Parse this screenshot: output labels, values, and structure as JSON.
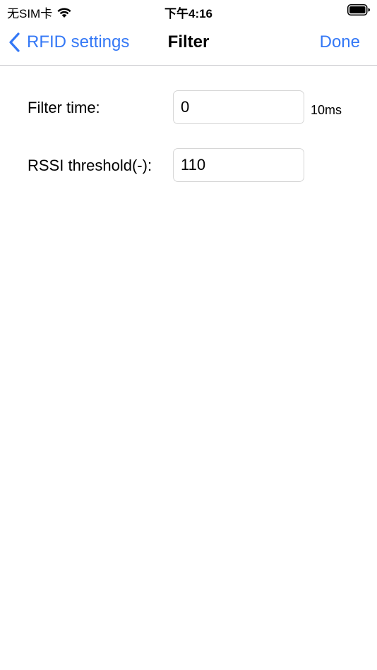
{
  "status_bar": {
    "carrier": "无SIM卡",
    "time": "下午4:16",
    "icons": [
      "wifi-icon",
      "battery-icon"
    ]
  },
  "nav": {
    "back_label": "RFID settings",
    "title": "Filter",
    "done_label": "Done",
    "accent_color": "#3478f6",
    "icons": [
      "chevron-left-icon"
    ]
  },
  "form": {
    "filter_time": {
      "label": "Filter time:",
      "value": "0",
      "unit": "10ms"
    },
    "rssi_threshold": {
      "label": "RSSI threshold(-):",
      "value": "110"
    }
  }
}
